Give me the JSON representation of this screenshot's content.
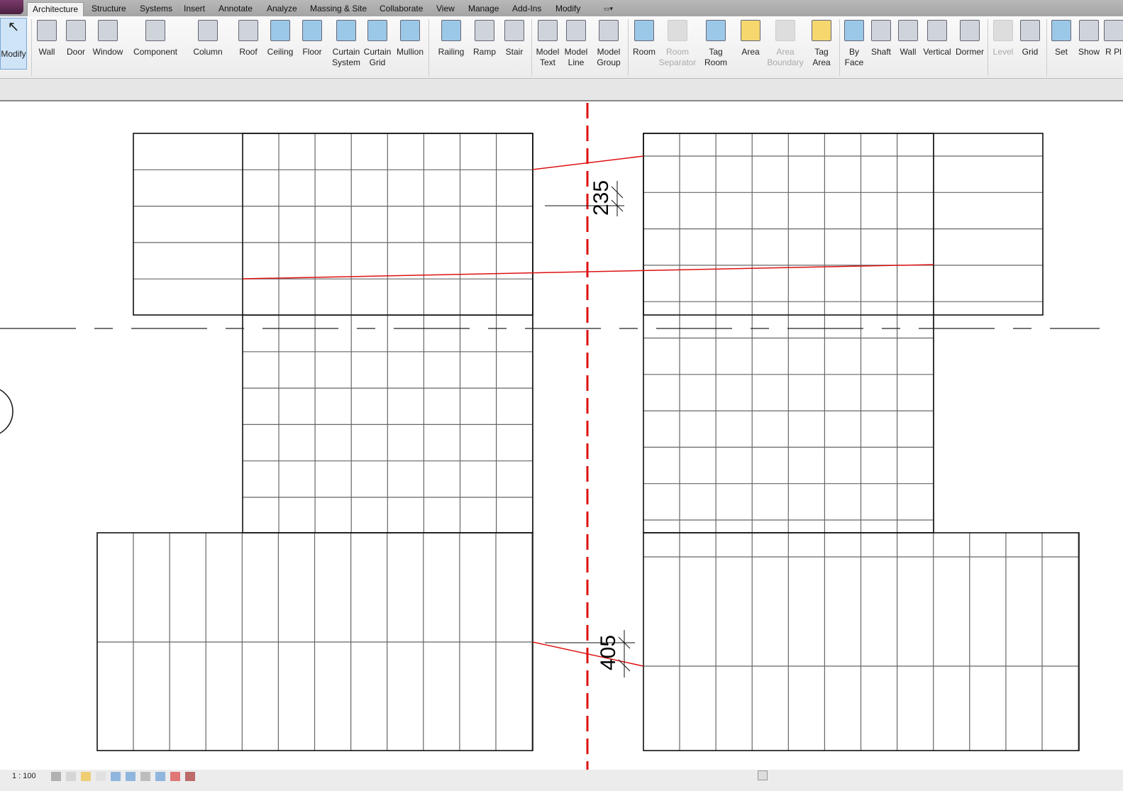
{
  "tabs": [
    "Architecture",
    "Structure",
    "Systems",
    "Insert",
    "Annotate",
    "Analyze",
    "Massing & Site",
    "Collaborate",
    "View",
    "Manage",
    "Add-Ins",
    "Modify"
  ],
  "active_tab": "Architecture",
  "ribbon": [
    {
      "label": "Modify",
      "icon": "cursor-icon",
      "selected": true
    },
    {
      "label": "Wall",
      "icon": "wall-icon",
      "dropdown": true
    },
    {
      "label": "Door",
      "icon": "door-icon"
    },
    {
      "label": "Window",
      "icon": "window-icon"
    },
    {
      "label": "Component",
      "icon": "component-icon",
      "dropdown": true
    },
    {
      "label": "Column",
      "icon": "column-icon",
      "dropdown": true
    },
    {
      "label": "Roof",
      "icon": "roof-icon",
      "dropdown": true
    },
    {
      "label": "Ceiling",
      "icon": "ceiling-icon"
    },
    {
      "label": "Floor",
      "icon": "floor-icon",
      "dropdown": true
    },
    {
      "label": "Curtain System",
      "icon": "curtain-system-icon"
    },
    {
      "label": "Curtain Grid",
      "icon": "curtain-grid-icon"
    },
    {
      "label": "Mullion",
      "icon": "mullion-icon"
    },
    {
      "label": "Railing",
      "icon": "railing-icon",
      "dropdown": true
    },
    {
      "label": "Ramp",
      "icon": "ramp-icon"
    },
    {
      "label": "Stair",
      "icon": "stair-icon",
      "dropdown": true
    },
    {
      "label": "Model Text",
      "icon": "model-text-icon"
    },
    {
      "label": "Model Line",
      "icon": "model-line-icon"
    },
    {
      "label": "Model Group",
      "icon": "model-group-icon",
      "dropdown": true
    },
    {
      "label": "Room",
      "icon": "room-icon"
    },
    {
      "label": "Room Separator",
      "icon": "room-separator-icon",
      "disabled": true
    },
    {
      "label": "Tag Room",
      "icon": "tag-room-icon",
      "dropdown": true
    },
    {
      "label": "Area",
      "icon": "area-icon",
      "dropdown": true
    },
    {
      "label": "Area Boundary",
      "icon": "area-boundary-icon",
      "disabled": true
    },
    {
      "label": "Tag Area",
      "icon": "tag-area-icon",
      "dropdown": true
    },
    {
      "label": "By Face",
      "icon": "by-face-icon"
    },
    {
      "label": "Shaft",
      "icon": "shaft-icon"
    },
    {
      "label": "Wall",
      "icon": "opening-wall-icon"
    },
    {
      "label": "Vertical",
      "icon": "vertical-icon"
    },
    {
      "label": "Dormer",
      "icon": "dormer-icon"
    },
    {
      "label": "Level",
      "icon": "level-icon",
      "disabled": true
    },
    {
      "label": "Grid",
      "icon": "grid-icon"
    },
    {
      "label": "Set",
      "icon": "set-icon"
    },
    {
      "label": "Show",
      "icon": "show-icon"
    },
    {
      "label": "R Pl",
      "icon": "ref-plane-icon"
    }
  ],
  "dimensions": [
    "235",
    "405"
  ],
  "status": {
    "scale": "1 : 100"
  },
  "colors": {
    "accent_red": "#dd1111",
    "ribbon_select": "#cfe4f7"
  }
}
